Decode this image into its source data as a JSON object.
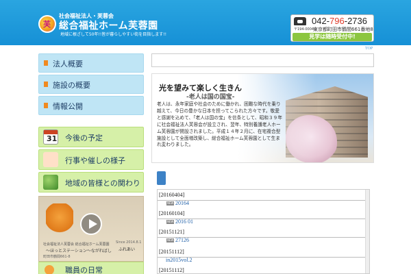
{
  "header": {
    "org_type": "社会福祉法人・芙蓉会",
    "org_name": "総合福祉ホーム芙蓉園",
    "tagline": "地域に根ざして50年!!皆が暮らしやすい街を目指します!!",
    "logo_char": "芙",
    "phone_prefix": "042-",
    "phone_hl": "796",
    "phone_suffix": "-2736",
    "zip": "〒194-0004",
    "address": "東京都町田市鶴間661番地8",
    "visit_label": "見学は随時受付中!",
    "accent": "#1690d6"
  },
  "top_link": "TOP",
  "nav": {
    "items": [
      {
        "label": "法人概要"
      },
      {
        "label": "施設の概要"
      },
      {
        "label": "情報公開"
      }
    ]
  },
  "side": {
    "items": [
      {
        "label": "今後の予定",
        "icon": "calendar-icon",
        "icon_text": "31"
      },
      {
        "label": "行事や催しの様子",
        "icon": "person-icon"
      },
      {
        "label": "地域の皆様との関わり",
        "icon": "globe-icon"
      }
    ],
    "video": {
      "cap1": "社会福祉法人芙蓉会 総合福祉ホーム芙蓉園",
      "cap2": "〜ほっとステーション〜ながればし",
      "cap3": "Since 2014.8.1",
      "cap4": "ふれあい",
      "cap5": "町田市鶴間661-8"
    },
    "staff_label": "職員の日常"
  },
  "hero": {
    "title": "光を望みて楽しく生きん",
    "subtitle": "-老人は国の国宝-",
    "body": "老人は、永年家庭や社会のために働かれ、困難な時代を乗り越えて、今日の豊かな日本を担ってこられた方々です。敬愛と感謝を込めて、「老人は国の宝」を信条として、昭和３９年に社会福祉法人芙蓉会が設立され、翌年、特別養護老人ホーム芙蓉園が開設されました。平成１４年２月に、在宅複合型施設として全面増改築し、総合福祉ホーム芙蓉園として生まれ変わりました。"
  },
  "news": {
    "badge": "NEW",
    "items": [
      {
        "date": "[20160404]",
        "title": "20164"
      },
      {
        "date": "[20160104]",
        "title": "2016 01"
      },
      {
        "date": "[20151121]",
        "title": "27126"
      },
      {
        "date": "[20151112]",
        "title": "in2015vol.2"
      },
      {
        "date": "[20151112]",
        "title": ""
      }
    ]
  }
}
